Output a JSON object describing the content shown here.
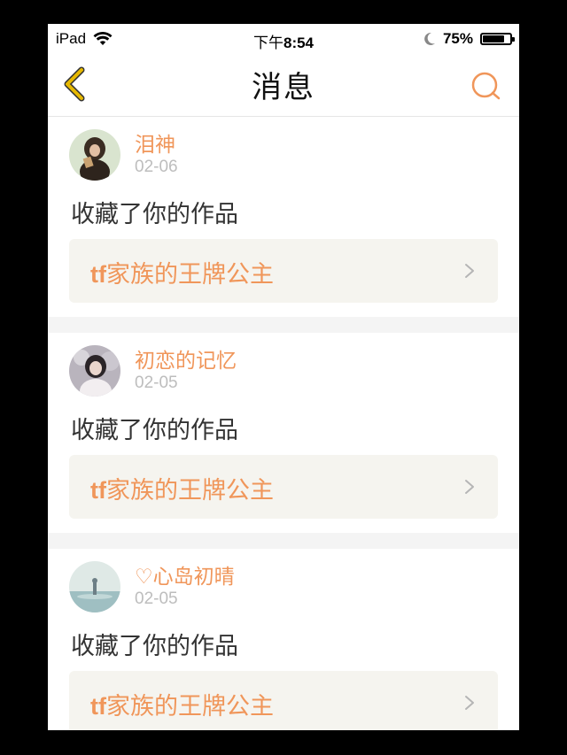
{
  "status_bar": {
    "device": "iPad",
    "time_prefix": "下午",
    "time": "8:54",
    "battery": "75%"
  },
  "nav": {
    "title": "消息"
  },
  "messages": [
    {
      "user": "泪神",
      "date": "02-06",
      "action": "收藏了你的作品",
      "work_prefix": "tf",
      "work_rest": "家族的王牌公主"
    },
    {
      "user": "初恋的记忆",
      "date": "02-05",
      "action": "收藏了你的作品",
      "work_prefix": "tf",
      "work_rest": "家族的王牌公主"
    },
    {
      "user": "♡心岛初晴",
      "date": "02-05",
      "action": "收藏了你的作品",
      "work_prefix": "tf",
      "work_rest": "家族的王牌公主"
    }
  ],
  "colors": {
    "accent": "#f0965a",
    "back_arrow": "#e6b800",
    "panel": "#f5f4ef"
  },
  "icons": {
    "back": "chevron-left-icon",
    "search": "search-icon",
    "wifi": "wifi-icon",
    "moon": "moon-icon",
    "battery": "battery-icon",
    "disclosure": "chevron-right-icon"
  }
}
